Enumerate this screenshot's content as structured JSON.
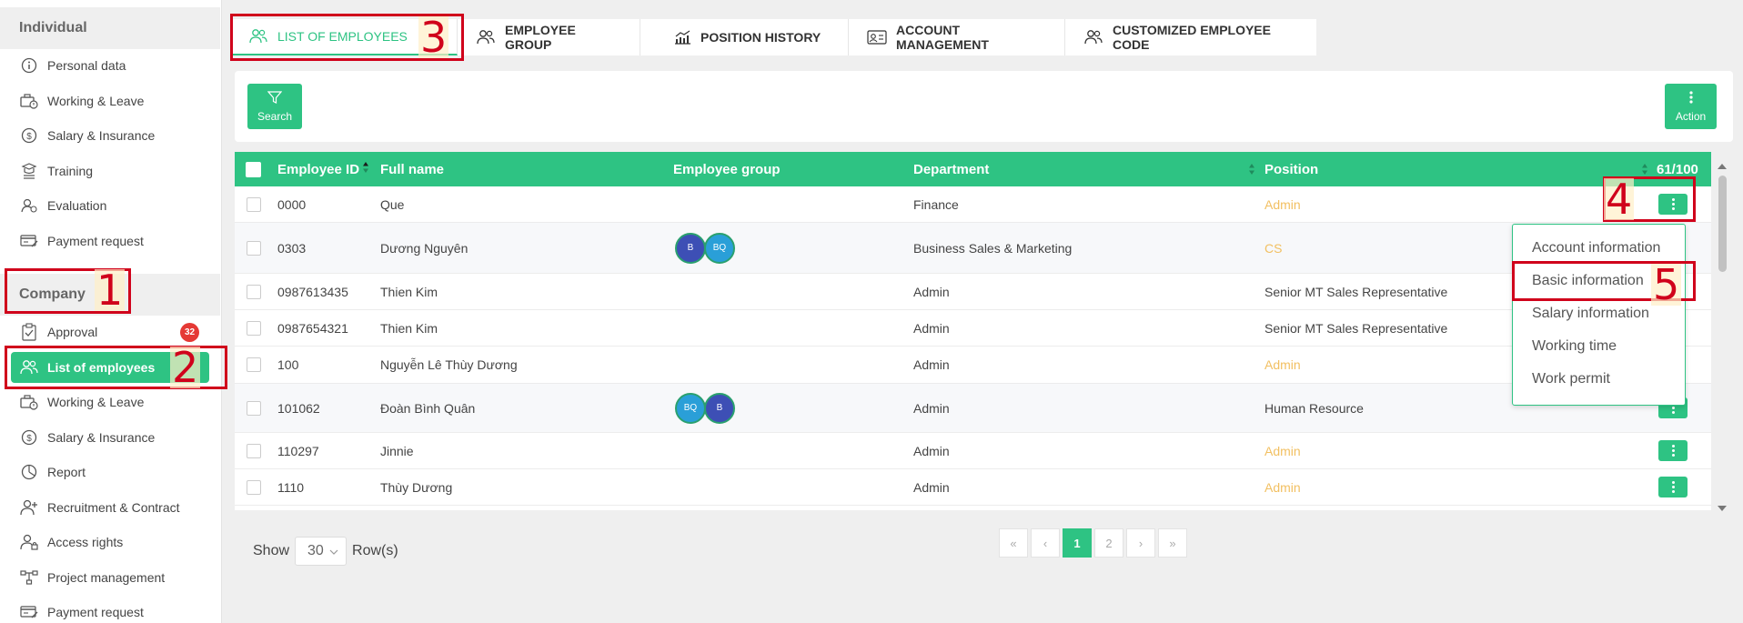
{
  "sidebar": {
    "individual_header": "Individual",
    "individual_items": [
      {
        "label": "Personal data",
        "icon": "info-icon"
      },
      {
        "label": "Working & Leave",
        "icon": "briefcase-clock-icon"
      },
      {
        "label": "Salary & Insurance",
        "icon": "dollar-icon"
      },
      {
        "label": "Training",
        "icon": "training-icon"
      },
      {
        "label": "Evaluation",
        "icon": "evaluation-icon"
      },
      {
        "label": "Payment request",
        "icon": "payment-icon"
      }
    ],
    "company_header": "Company",
    "company_items": [
      {
        "label": "Approval",
        "icon": "approval-icon",
        "badge": "32"
      },
      {
        "label": "List of employees",
        "icon": "users-icon",
        "active": true
      },
      {
        "label": "Working & Leave",
        "icon": "briefcase-clock-icon"
      },
      {
        "label": "Salary & Insurance",
        "icon": "dollar-icon"
      },
      {
        "label": "Report",
        "icon": "pie-chart-icon"
      },
      {
        "label": "Recruitment & Contract",
        "icon": "user-plus-icon"
      },
      {
        "label": "Access rights",
        "icon": "user-lock-icon"
      },
      {
        "label": "Project management",
        "icon": "project-icon"
      },
      {
        "label": "Payment request",
        "icon": "payment-icon"
      }
    ]
  },
  "tabs": [
    {
      "label": "LIST OF EMPLOYEES",
      "icon": "users-icon",
      "active": true
    },
    {
      "label": "EMPLOYEE GROUP",
      "icon": "users-icon"
    },
    {
      "label": "POSITION HISTORY",
      "icon": "chart-icon"
    },
    {
      "label": "ACCOUNT MANAGEMENT",
      "icon": "id-card-icon"
    },
    {
      "label": "CUSTOMIZED EMPLOYEE CODE",
      "icon": "users-icon"
    }
  ],
  "toolbar": {
    "search_label": "Search",
    "action_label": "Action"
  },
  "table": {
    "headers": {
      "employee_id": "Employee ID",
      "full_name": "Full name",
      "employee_group": "Employee group",
      "department": "Department",
      "position": "Position",
      "columns_count": "61/100"
    },
    "rows": [
      {
        "id": "0000",
        "name": "Que",
        "groups": [],
        "department": "Finance",
        "position": "Admin",
        "position_style": "admin"
      },
      {
        "id": "0303",
        "name": "Dương Nguyên",
        "groups": [
          "B",
          "BQ"
        ],
        "department": "Business Sales & Marketing",
        "position": "CS",
        "position_style": "admin"
      },
      {
        "id": "0987613435",
        "name": "Thien Kim",
        "groups": [],
        "department": "Admin",
        "position": "Senior MT Sales Representative",
        "position_style": "normal"
      },
      {
        "id": "0987654321",
        "name": "Thien Kim",
        "groups": [],
        "department": "Admin",
        "position": "Senior MT Sales Representative",
        "position_style": "normal"
      },
      {
        "id": "100",
        "name": "Nguyễn Lê Thùy Dương",
        "groups": [],
        "department": "Admin",
        "position": "Admin",
        "position_style": "admin"
      },
      {
        "id": "101062",
        "name": "Đoàn Bình Quân",
        "groups": [
          "BQ",
          "B"
        ],
        "department": "Admin",
        "position": "Human Resource",
        "position_style": "normal"
      },
      {
        "id": "110297",
        "name": "Jinnie",
        "groups": [],
        "department": "Admin",
        "position": "Admin",
        "position_style": "admin"
      },
      {
        "id": "1110",
        "name": "Thùy Dương",
        "groups": [],
        "department": "Admin",
        "position": "Admin",
        "position_style": "admin"
      }
    ]
  },
  "dropdown": {
    "items": [
      "Account information",
      "Basic information",
      "Salary information",
      "Working time",
      "Work permit"
    ]
  },
  "footer": {
    "show_label": "Show",
    "rows_value": "30",
    "rows_suffix": "Row(s)",
    "pages": [
      "«",
      "‹",
      "1",
      "2",
      "›",
      "»"
    ],
    "current_page": "1"
  },
  "annotations": [
    "1",
    "2",
    "3",
    "4",
    "5"
  ],
  "colors": {
    "accent": "#2ec383",
    "annotation_red": "#d0021b",
    "admin_position": "#f2c062",
    "badge": "#e53935"
  }
}
